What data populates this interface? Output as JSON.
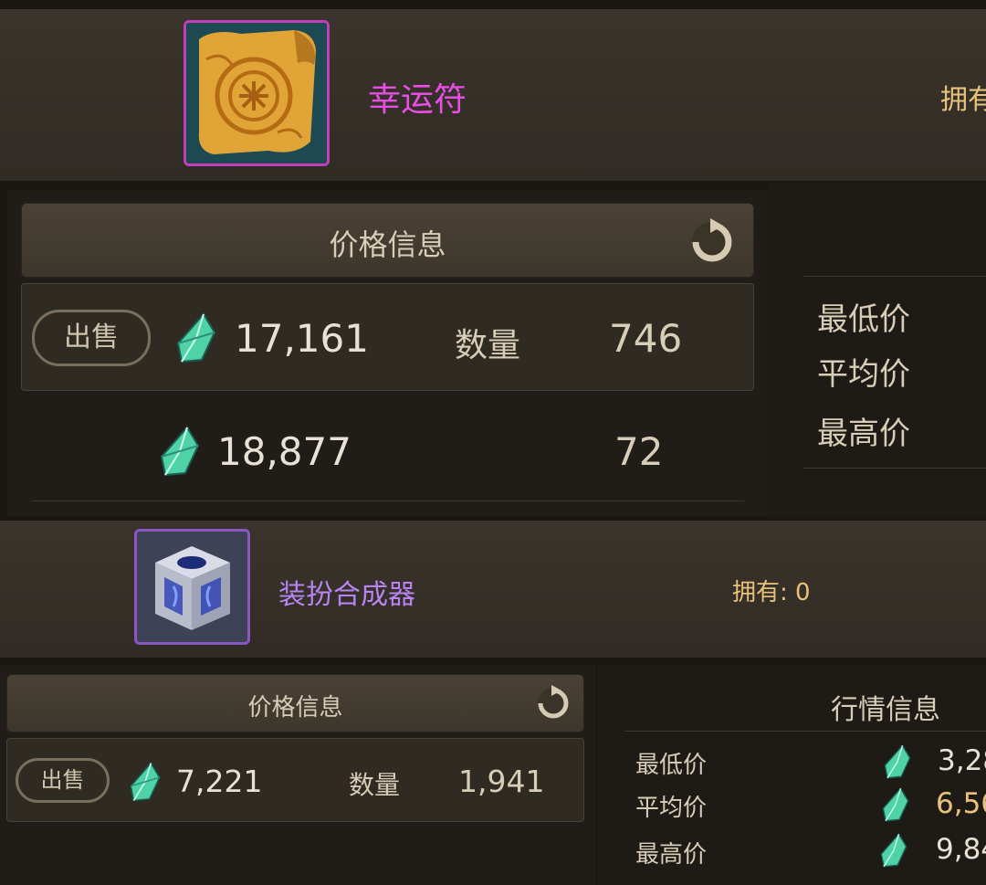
{
  "item1": {
    "name": "幸运符",
    "owned_label_partial": "拥有",
    "price_header": "价格信息",
    "sell_label": "出售",
    "listing1_price": "17,161",
    "quantity_label": "数量",
    "listing1_qty": "746",
    "listing2_price": "18,877",
    "listing2_qty": "72",
    "market": {
      "lowest_label": "最低价",
      "average_label": "平均价",
      "highest_label": "最高价"
    }
  },
  "item2": {
    "name": "装扮合成器",
    "owned": "拥有: 0",
    "price_header": "价格信息",
    "sell_label": "出售",
    "listing1_price": "7,221",
    "quantity_label": "数量",
    "listing1_qty": "1,941",
    "market_header": "行情信息",
    "market": {
      "lowest_label": "最低价",
      "lowest_value": "3,28",
      "average_label": "平均价",
      "average_value": "6,56",
      "highest_label": "最高价",
      "highest_value": "9,84"
    }
  },
  "colors": {
    "item1_name": "#e84ee6",
    "item2_name": "#b884f2",
    "gold_text": "#e8c27a",
    "gem": "#4fd3a6"
  },
  "icons": {
    "item1": "lucky-charm-scroll-icon",
    "item2": "crystal-cube-icon",
    "currency": "gem-icon",
    "refresh": "refresh-icon"
  }
}
